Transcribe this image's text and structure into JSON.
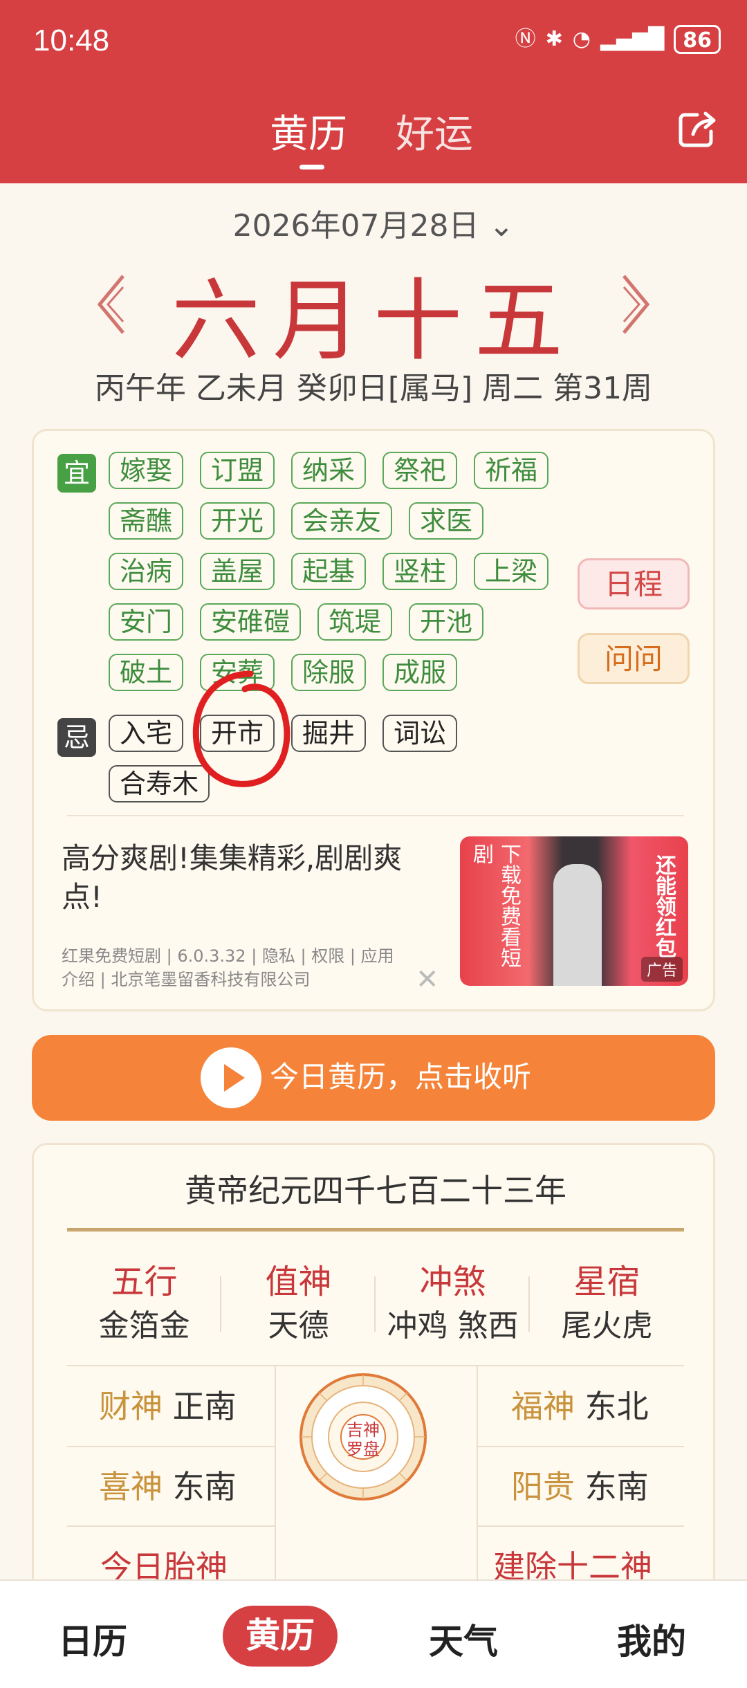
{
  "status": {
    "time": "10:48",
    "battery": "86",
    "signal_label": "6"
  },
  "header": {
    "tab_active": "黄历",
    "tab_inactive": "好运"
  },
  "date": {
    "gregorian": "2026年07月28日",
    "dropdown": "⌄",
    "lunar": "六月十五",
    "ganzhi": "丙午年 乙未月 癸卯日[属马] 周二 第31周"
  },
  "yiji": {
    "yi_label": "宜",
    "yi": [
      "嫁娶",
      "订盟",
      "纳采",
      "祭祀",
      "祈福",
      "斋醮",
      "开光",
      "会亲友",
      "求医",
      "治病",
      "盖屋",
      "起基",
      "竖柱",
      "上梁",
      "安门",
      "安碓磑",
      "筑堤",
      "开池",
      "破土",
      "安葬",
      "除服",
      "成服"
    ],
    "ji_label": "忌",
    "ji": [
      "入宅",
      "开市",
      "掘井",
      "词讼",
      "合寿木"
    ],
    "schedule_btn": "日程",
    "ask_btn": "问问"
  },
  "ad": {
    "title": "高分爽剧!集集精彩,剧剧爽点!",
    "meta": "红果免费短剧 | 6.0.3.32 | 隐私 | 权限 | 应用介绍 | 北京笔墨留香科技有限公司",
    "img_left": "下载免费看短剧",
    "img_right": "还能领红包",
    "img_label": "广告",
    "close": "✕"
  },
  "listen": {
    "text": "今日黄历，点击收听"
  },
  "info": {
    "era": "黄帝纪元四千七百二十三年",
    "cols": [
      {
        "h": "五行",
        "v": "金箔金"
      },
      {
        "h": "值神",
        "v": "天德"
      },
      {
        "h": "冲煞",
        "v": "冲鸡 煞西"
      },
      {
        "h": "星宿",
        "v": "尾火虎"
      }
    ],
    "caishen_k": "财神",
    "caishen_v": "正南",
    "fushen_k": "福神",
    "fushen_v": "东北",
    "xishen_k": "喜神",
    "xishen_v": "东南",
    "yanggui_k": "阳贵",
    "yanggui_v": "东南",
    "taishen": "今日胎神",
    "jianchu": "建除十二神",
    "compass_text1": "吉神",
    "compass_text2": "罗盘"
  },
  "bottom_nav": {
    "calendar": "日历",
    "almanac": "黄历",
    "weather": "天气",
    "mine": "我的"
  },
  "colors": {
    "header": "#d64042",
    "accent_orange": "#f5843a",
    "yi_green": "#48a045",
    "lunar_red": "#c8373a"
  }
}
